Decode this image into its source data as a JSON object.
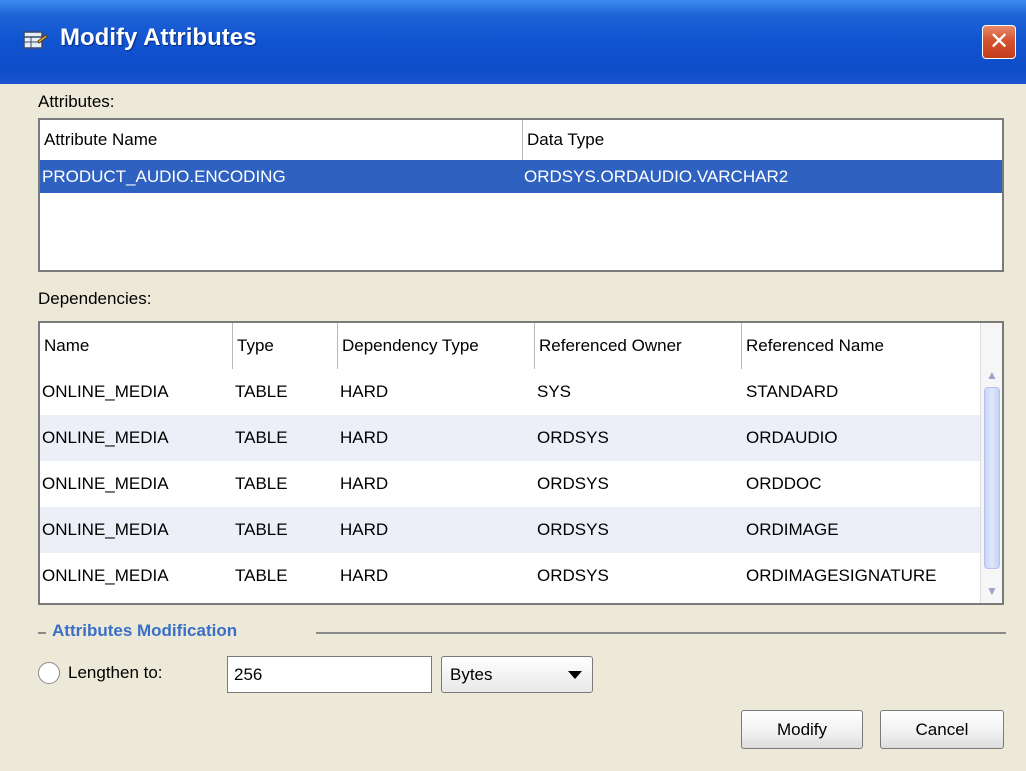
{
  "window": {
    "title": "Modify Attributes",
    "close_glyph": "✕",
    "icon": "table-icon"
  },
  "attributes": {
    "label": "Attributes:",
    "columns": [
      "Attribute Name",
      "Data Type"
    ],
    "rows": [
      [
        "PRODUCT_AUDIO.ENCODING",
        "ORDSYS.ORDAUDIO.VARCHAR2"
      ]
    ]
  },
  "dependencies": {
    "label": "Dependencies:",
    "columns": [
      "Name",
      "Type",
      "Dependency Type",
      "Referenced Owner",
      "Referenced Name"
    ],
    "rows": [
      [
        "ONLINE_MEDIA",
        "TABLE",
        "HARD",
        "SYS",
        "STANDARD"
      ],
      [
        "ONLINE_MEDIA",
        "TABLE",
        "HARD",
        "ORDSYS",
        "ORDAUDIO"
      ],
      [
        "ONLINE_MEDIA",
        "TABLE",
        "HARD",
        "ORDSYS",
        "ORDDOC"
      ],
      [
        "ONLINE_MEDIA",
        "TABLE",
        "HARD",
        "ORDSYS",
        "ORDIMAGE"
      ],
      [
        "ONLINE_MEDIA",
        "TABLE",
        "HARD",
        "ORDSYS",
        "ORDIMAGESIGNATURE"
      ]
    ]
  },
  "modification": {
    "section_title": "Attributes Modification",
    "lengthen_label": "Lengthen to:",
    "lengthen_value": "256",
    "unit_selected": "Bytes"
  },
  "buttons": {
    "modify": "Modify",
    "cancel": "Cancel"
  },
  "colors": {
    "selection": "#2f62c0",
    "section_title": "#3a6fc8",
    "titlebar": "#0f4cc8"
  }
}
